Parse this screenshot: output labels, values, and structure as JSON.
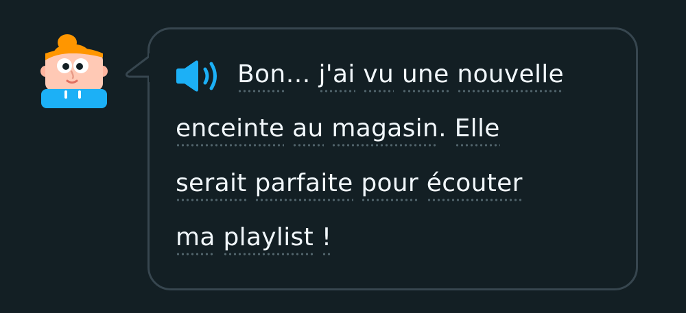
{
  "character": {
    "name_icon": "character-avatar-icon"
  },
  "audio": {
    "icon": "speaker-icon",
    "color": "#1cb0f6"
  },
  "sentence": {
    "line1": [
      {
        "t": "Bon",
        "w": true
      },
      {
        "t": "… ",
        "w": false
      },
      {
        "t": "j'ai",
        "w": true
      },
      {
        "t": " ",
        "w": false
      },
      {
        "t": "vu",
        "w": true
      },
      {
        "t": " ",
        "w": false
      },
      {
        "t": "une",
        "w": true
      },
      {
        "t": " ",
        "w": false
      },
      {
        "t": "nouvelle",
        "w": true
      }
    ],
    "line2": [
      {
        "t": "enceinte",
        "w": true
      },
      {
        "t": " ",
        "w": false
      },
      {
        "t": "au",
        "w": true
      },
      {
        "t": " ",
        "w": false
      },
      {
        "t": "magasin",
        "w": true
      },
      {
        "t": ". ",
        "w": false
      },
      {
        "t": "Elle",
        "w": true
      }
    ],
    "line3": [
      {
        "t": "serait",
        "w": true
      },
      {
        "t": " ",
        "w": false
      },
      {
        "t": "parfaite",
        "w": true
      },
      {
        "t": " ",
        "w": false
      },
      {
        "t": "pour",
        "w": true
      },
      {
        "t": " ",
        "w": false
      },
      {
        "t": "écouter",
        "w": true
      }
    ],
    "line4": [
      {
        "t": "ma",
        "w": true
      },
      {
        "t": " ",
        "w": false
      },
      {
        "t": "playlist",
        "w": true
      },
      {
        "t": " ",
        "w": false
      },
      {
        "t": "!",
        "w": true
      }
    ]
  },
  "colors": {
    "background": "#131f24",
    "bubble_border": "#37464f",
    "text": "#f1f7fb",
    "dotted_underline": "#52656d"
  }
}
